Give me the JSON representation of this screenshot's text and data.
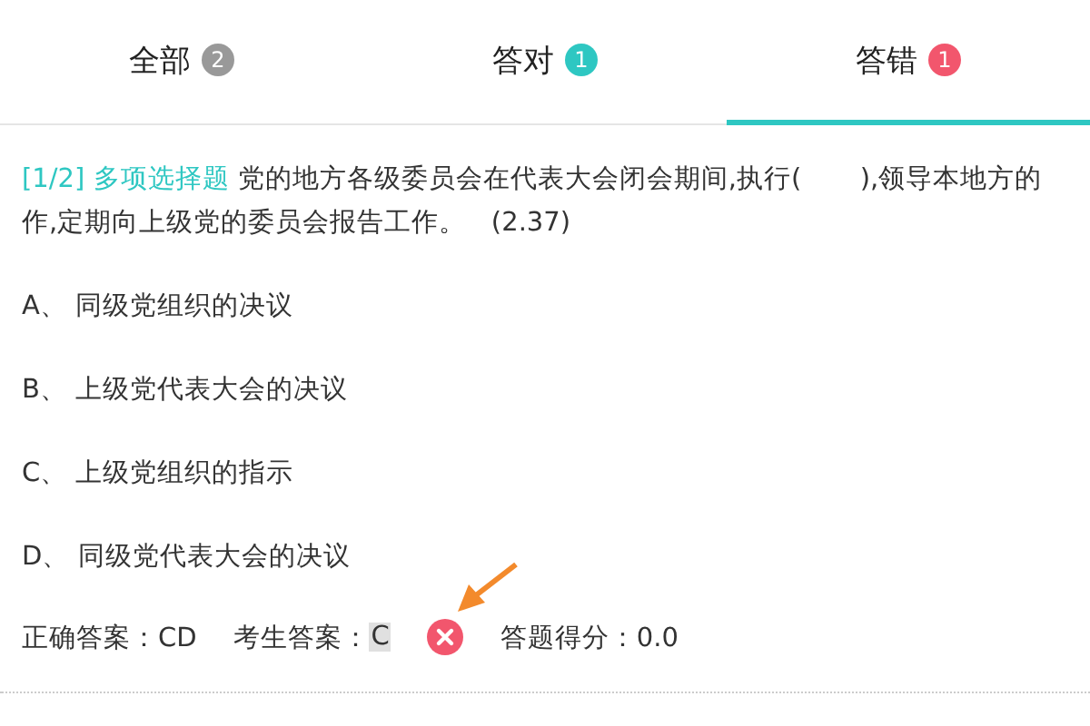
{
  "tabs": [
    {
      "label": "全部",
      "count": "2",
      "color": "#999999",
      "selected": false
    },
    {
      "label": "答对",
      "count": "1",
      "color": "#2ec7c2",
      "selected": false
    },
    {
      "label": "答错",
      "count": "1",
      "color": "#f2566d",
      "selected": true
    }
  ],
  "question": {
    "tag": "[1/2] 多项选择题",
    "text": "党的地方各级委员会在代表大会闭会期间,执行(       ),领导本地方的作,定期向上级党的委员会报告工作。   (2.37)"
  },
  "options": [
    "A、 同级党组织的决议",
    "B、 上级党代表大会的决议",
    "C、 上级党组织的指示",
    "D、 同级党代表大会的决议"
  ],
  "result": {
    "correct_label": "正确答案：CD",
    "user_label": "考生答案：",
    "user_answer": "C",
    "wrong": true,
    "score": "答题得分：0.0"
  }
}
